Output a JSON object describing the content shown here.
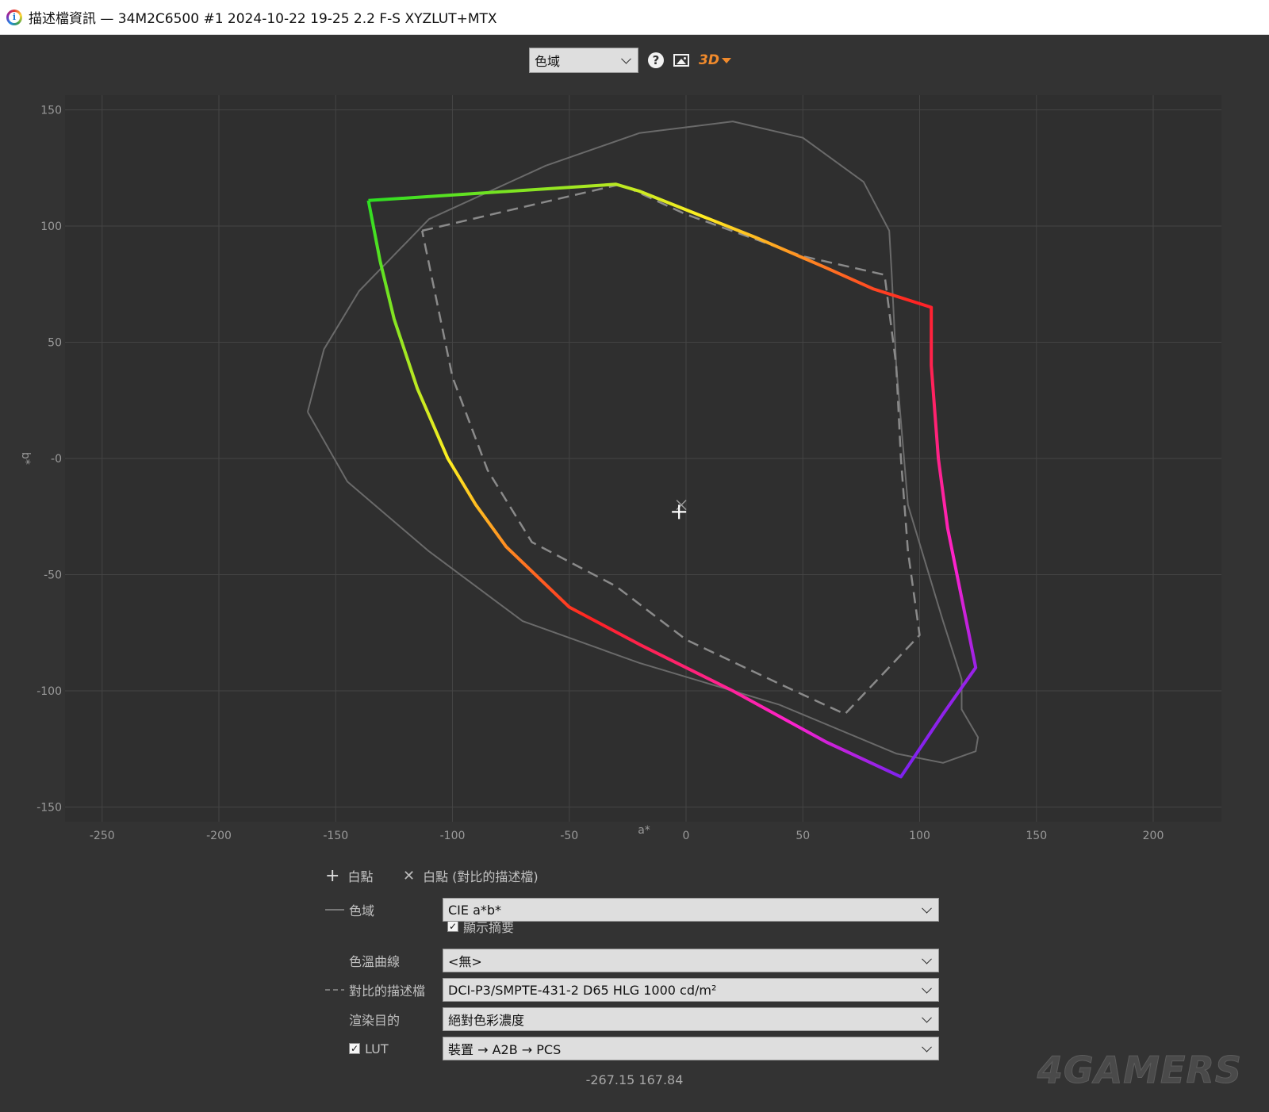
{
  "window": {
    "title": "描述檔資訊 — 34M2C6500 #1 2024-10-22 19-25 2.2 F-S XYZLUT+MTX"
  },
  "toolbar": {
    "view_select": "色域",
    "help_icon": "help-icon",
    "image_icon": "image-icon",
    "threed_label": "3D"
  },
  "chart_data": {
    "type": "line",
    "xlabel": "a*",
    "ylabel": "b*",
    "xlim": [
      -250,
      220
    ],
    "ylim": [
      -150,
      150
    ],
    "xticks": [
      -250,
      -200,
      -150,
      -100,
      -50,
      0,
      50,
      100,
      150,
      200
    ],
    "yticks": [
      150,
      100,
      50,
      0,
      -50,
      -100,
      -150
    ],
    "ytick_labels": [
      "150",
      "100",
      "50",
      "-0",
      "-50",
      "-100",
      "-150"
    ],
    "grid": true,
    "series": [
      {
        "style": "gradient",
        "points": [
          [
            -136,
            111
          ],
          [
            -30,
            118
          ],
          [
            -20,
            115
          ],
          [
            0,
            107
          ],
          [
            30,
            95
          ],
          [
            60,
            82
          ],
          [
            80,
            73
          ],
          [
            105,
            65
          ],
          [
            105,
            40
          ],
          [
            108,
            0
          ],
          [
            112,
            -30
          ],
          [
            118,
            -60
          ],
          [
            124,
            -90
          ],
          [
            110,
            -110
          ],
          [
            92,
            -137
          ],
          [
            60,
            -122
          ],
          [
            20,
            -100
          ],
          [
            -20,
            -80
          ],
          [
            -50,
            -64
          ],
          [
            -77,
            -38
          ],
          [
            -90,
            -20
          ],
          [
            -102,
            0
          ],
          [
            -115,
            30
          ],
          [
            -125,
            60
          ],
          [
            -131,
            85
          ],
          [
            -136,
            111
          ]
        ]
      },
      {
        "style": "dashed",
        "points": [
          [
            -113,
            98
          ],
          [
            -28,
            118
          ],
          [
            0,
            105
          ],
          [
            50,
            87
          ],
          [
            85,
            79
          ],
          [
            90,
            40
          ],
          [
            92,
            0
          ],
          [
            95,
            -40
          ],
          [
            100,
            -76
          ],
          [
            68,
            -110
          ],
          [
            40,
            -97
          ],
          [
            0,
            -78
          ],
          [
            -30,
            -55
          ],
          [
            -66,
            -36
          ],
          [
            -85,
            -5
          ],
          [
            -100,
            35
          ],
          [
            -113,
            98
          ]
        ]
      },
      {
        "style": "solid",
        "points": [
          [
            -162,
            20
          ],
          [
            -155,
            47
          ],
          [
            -140,
            72
          ],
          [
            -110,
            103
          ],
          [
            -60,
            126
          ],
          [
            -20,
            140
          ],
          [
            20,
            145
          ],
          [
            50,
            138
          ],
          [
            76,
            119
          ],
          [
            87,
            98
          ],
          [
            88,
            80
          ],
          [
            90,
            40
          ],
          [
            95,
            -20
          ],
          [
            110,
            -70
          ],
          [
            118,
            -95
          ],
          [
            118,
            -108
          ],
          [
            125,
            -120
          ],
          [
            124,
            -126
          ],
          [
            110,
            -131
          ],
          [
            90,
            -127
          ],
          [
            40,
            -106
          ],
          [
            -20,
            -88
          ],
          [
            -70,
            -70
          ],
          [
            -110,
            -40
          ],
          [
            -145,
            -10
          ],
          [
            -162,
            20
          ]
        ]
      }
    ],
    "white_point": [
      -3,
      -23
    ],
    "white_point_ref": [
      -2,
      -20
    ]
  },
  "controls": {
    "whitepoint_label": "白點",
    "whitepoint_ref_label": "白點 (對比的描述檔)",
    "gamut_label": "色域",
    "gamut_value": "CIE a*b*",
    "summary_label": "顯示摘要",
    "curve_label": "色溫曲線",
    "curve_value": "<無>",
    "compare_label": "對比的描述檔",
    "compare_value": "DCI-P3/SMPTE-431-2 D65 HLG 1000 cd/m²",
    "intent_label": "渲染目的",
    "intent_value": "絕對色彩濃度",
    "lut_label": "LUT",
    "lut_value": "裝置 → A2B → PCS",
    "coords": "-267.15 167.84"
  },
  "watermark": "4GAMERS"
}
